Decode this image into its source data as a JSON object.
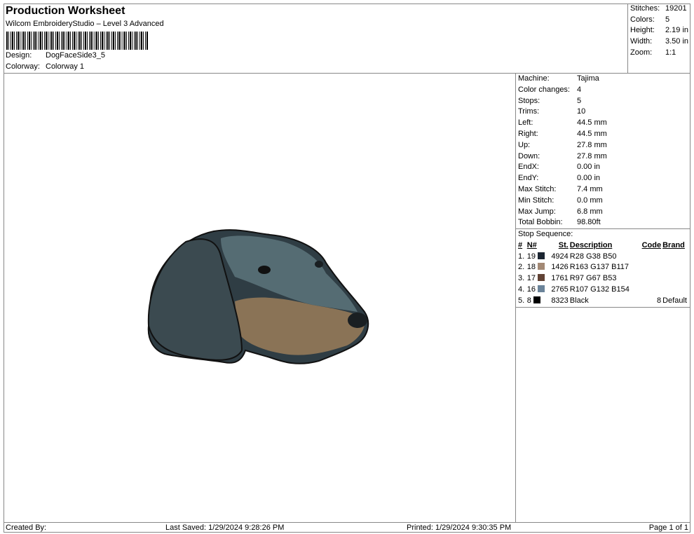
{
  "header": {
    "title": "Production Worksheet",
    "subtitle": "Wilcom EmbroideryStudio – Level 3 Advanced",
    "design_label": "Design:",
    "design": "DogFaceSide3_5",
    "colorway_label": "Colorway:",
    "colorway": "Colorway 1"
  },
  "summary": [
    {
      "k": "Stitches:",
      "v": "19201"
    },
    {
      "k": "Colors:",
      "v": "5"
    },
    {
      "k": "Height:",
      "v": "2.19 in"
    },
    {
      "k": "Width:",
      "v": "3.50 in"
    },
    {
      "k": "Zoom:",
      "v": "1:1"
    }
  ],
  "machine": [
    {
      "k": "Machine:",
      "v": "Tajima"
    },
    {
      "k": "Color changes:",
      "v": "4"
    },
    {
      "k": "Stops:",
      "v": "5"
    },
    {
      "k": "Trims:",
      "v": "10"
    },
    {
      "k": "Left:",
      "v": "44.5 mm"
    },
    {
      "k": "Right:",
      "v": "44.5 mm"
    },
    {
      "k": "Up:",
      "v": "27.8 mm"
    },
    {
      "k": "Down:",
      "v": "27.8 mm"
    },
    {
      "k": "EndX:",
      "v": "0.00 in"
    },
    {
      "k": "EndY:",
      "v": "0.00 in"
    },
    {
      "k": "Max Stitch:",
      "v": "7.4 mm"
    },
    {
      "k": "Min Stitch:",
      "v": "0.0 mm"
    },
    {
      "k": "Max Jump:",
      "v": "6.8 mm"
    },
    {
      "k": "Total Bobbin:",
      "v": "98.80ft"
    }
  ],
  "stop_sequence": {
    "title": "Stop Sequence:",
    "headers": [
      "#",
      "N#",
      "St.",
      "Description",
      "Code",
      "Brand"
    ],
    "rows": [
      {
        "i": "1.",
        "n": "19",
        "color": "#1c2632",
        "st": "4924",
        "desc": "R28 G38 B50",
        "code": "",
        "brand": ""
      },
      {
        "i": "2.",
        "n": "18",
        "color": "#a38975",
        "st": "1426",
        "desc": "R163 G137 B117",
        "code": "",
        "brand": ""
      },
      {
        "i": "3.",
        "n": "17",
        "color": "#614335",
        "st": "1761",
        "desc": "R97 G67 B53",
        "code": "",
        "brand": ""
      },
      {
        "i": "4.",
        "n": "16",
        "color": "#6b849a",
        "st": "2765",
        "desc": "R107 G132 B154",
        "code": "",
        "brand": ""
      },
      {
        "i": "5.",
        "n": "8",
        "color": "#000000",
        "st": "8323",
        "desc": "Black",
        "code": "8",
        "brand": "Default"
      }
    ]
  },
  "footer": {
    "created": "Created By:",
    "saved": "Last Saved: 1/29/2024 9:28:26 PM",
    "printed": "Printed: 1/29/2024 9:30:35 PM",
    "page": "Page 1 of 1"
  }
}
